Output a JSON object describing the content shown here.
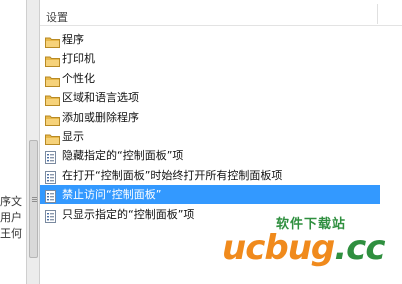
{
  "left_pane": {
    "fragments": [
      "序文",
      "用户",
      "王何"
    ]
  },
  "list": {
    "column_header": "设置",
    "items": [
      {
        "label": "程序",
        "icon": "folder-icon",
        "selected": false
      },
      {
        "label": "打印机",
        "icon": "folder-icon",
        "selected": false
      },
      {
        "label": "个性化",
        "icon": "folder-icon",
        "selected": false
      },
      {
        "label": "区域和语言选项",
        "icon": "folder-icon",
        "selected": false
      },
      {
        "label": "添加或删除程序",
        "icon": "folder-icon",
        "selected": false
      },
      {
        "label": "显示",
        "icon": "folder-icon",
        "selected": false
      },
      {
        "label": "隐藏指定的“控制面板”项",
        "icon": "setting-icon",
        "selected": false
      },
      {
        "label": "在打开“控制面板”时始终打开所有控制面板项",
        "icon": "setting-icon",
        "selected": false
      },
      {
        "label": "禁止访问“控制面板”",
        "icon": "setting-icon",
        "selected": true
      },
      {
        "label": "只显示指定的“控制面板”项",
        "icon": "setting-icon",
        "selected": false
      }
    ]
  },
  "watermark": {
    "subtitle": "软件下载站",
    "logo_main": "ucbug",
    "logo_dot": ".cc"
  },
  "colors": {
    "selection": "#3399ff",
    "folder": "#e8b84a",
    "logo_orange": "#f08a1c",
    "logo_green": "#2f8f3f"
  }
}
